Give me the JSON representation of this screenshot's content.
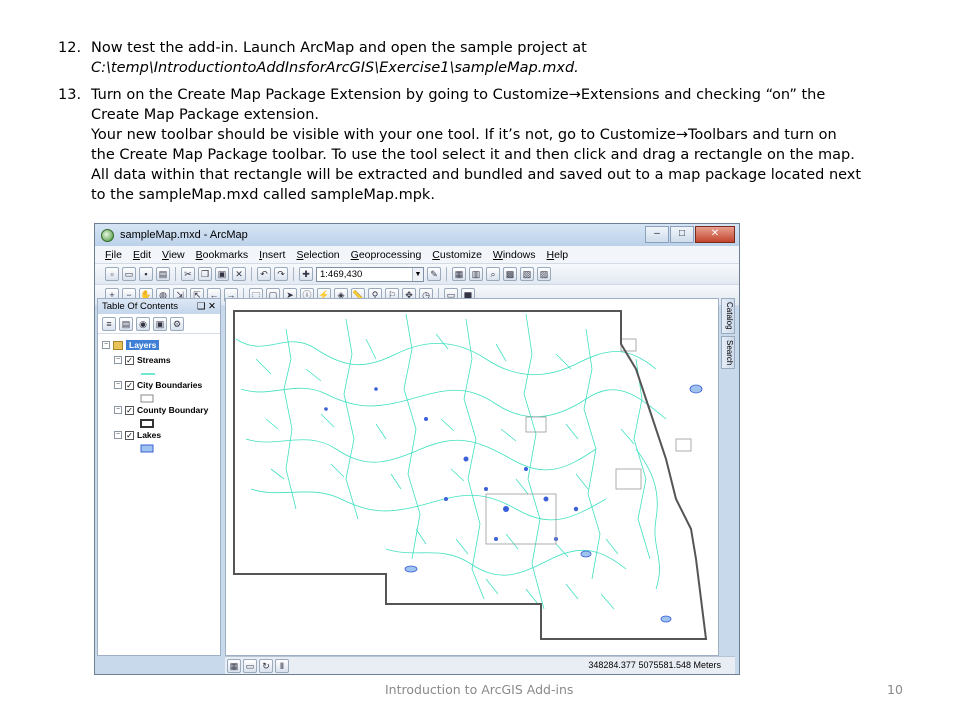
{
  "instructions": {
    "step12": {
      "number": "12.",
      "line1": "Now test the add-in.  Launch ArcMap and open the sample project at",
      "line2": "C:\\temp\\IntroductiontoAddInsforArcGIS\\Exercise1\\sampleMap.mxd."
    },
    "step13": {
      "number": "13.",
      "line1_a": "Turn on the Create Map Package Extension by going to Customize",
      "line1_b": "Extensions and checking “on” the",
      "line2": "Create Map Package extension.",
      "line3_a": "Your new toolbar should be visible with your one tool.  If it’s not, go to Customize",
      "line3_b": "Toolbars and turn on",
      "line4": "the Create Map Package toolbar. To use the tool select it and then click and drag a rectangle on the map.",
      "line5": "All data within that rectangle will be extracted and bundled and saved out to a map package located next",
      "line6": "to the sampleMap.mxd called sampleMap.mpk."
    },
    "arrow_glyph": "→"
  },
  "window": {
    "title": "sampleMap.mxd - ArcMap",
    "controls": {
      "minimize": "–",
      "maximize": "□",
      "close": "✕"
    }
  },
  "menu": [
    "File",
    "Edit",
    "View",
    "Bookmarks",
    "Insert",
    "Selection",
    "Geoprocessing",
    "Customize",
    "Windows",
    "Help"
  ],
  "toolbar": {
    "scale_value": "1:469,430"
  },
  "toc": {
    "title": "Table Of Contents",
    "pin": "❑ ✕",
    "root": "Layers",
    "layers": [
      {
        "name": "Streams"
      },
      {
        "name": "City Boundaries"
      },
      {
        "name": "County Boundary"
      },
      {
        "name": "Lakes"
      }
    ]
  },
  "dock": {
    "catalog": "Catalog",
    "search": "Search"
  },
  "status": {
    "coordinates": "348284.377  5075581.548 Meters"
  },
  "footer": {
    "title": "Introduction to ArcGIS Add-ins",
    "page": "10"
  },
  "colors": {
    "streams": "#40e0c0",
    "lakes": "#3b5fd8",
    "lake_fill": "#9ec3ee",
    "county": "#555555",
    "city": "#999999"
  }
}
